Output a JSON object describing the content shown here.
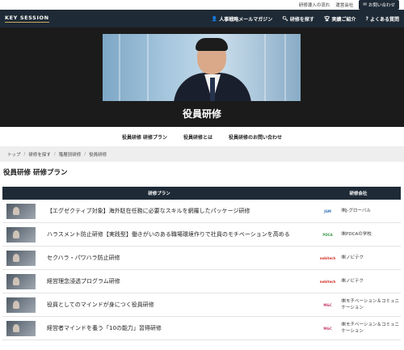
{
  "topbar": {
    "links": [
      "研修導入の流れ",
      "運営会社"
    ],
    "contact_label": "お問い合わせ"
  },
  "header": {
    "logo": "KEY SESSION",
    "nav": [
      {
        "label": "人事戦略メールマガジン",
        "icon": "person-icon"
      },
      {
        "label": "研修を探す",
        "icon": "search-icon"
      },
      {
        "label": "実績ご紹介",
        "icon": "trophy-icon"
      },
      {
        "label": "よくある質問",
        "icon": "question-icon"
      }
    ]
  },
  "hero": {
    "title": "役員研修"
  },
  "subnav": [
    "役員研修 研修プラン",
    "役員研修とは",
    "役員研修のお問い合わせ"
  ],
  "breadcrumb": [
    "トップ",
    "研修を探す",
    "階層別研修",
    "役員研修"
  ],
  "section_title": "役員研修 研修プラン",
  "table": {
    "headers": [
      "研修プラン",
      "研修会社"
    ],
    "rows": [
      {
        "title": "【エグゼクティブ対象】海外駐在任務に必要なスキルを網羅したパッケージ研修",
        "company": "㈱J-グローバル",
        "logo_text": "JGM",
        "logo_color": "#2f6eb5"
      },
      {
        "title": "ハラスメント防止研修【実践型】働きがいのある職場環境作りで社員のモチベーションを高める",
        "company": "㈱PDCAの学校",
        "logo_text": "PDCA",
        "logo_color": "#3a9a4a"
      },
      {
        "title": "セクハラ・パワハラ防止研修",
        "company": "㈱ノビテク",
        "logo_text": "nobitech",
        "logo_color": "#d3332a"
      },
      {
        "title": "経営理念浸透プログラム研修",
        "company": "㈱ノビテク",
        "logo_text": "nobitech",
        "logo_color": "#d3332a"
      },
      {
        "title": "役員としてのマインドが身につく役員研修",
        "company": "㈱モチベーション＆コミュニケーション",
        "logo_text": "M&C",
        "logo_color": "#c43a6a"
      },
      {
        "title": "経営者マインドを養う「10の能力」習得研修",
        "company": "㈱モチベーション＆コミュニケーション",
        "logo_text": "M&C",
        "logo_color": "#c43a6a"
      }
    ]
  }
}
